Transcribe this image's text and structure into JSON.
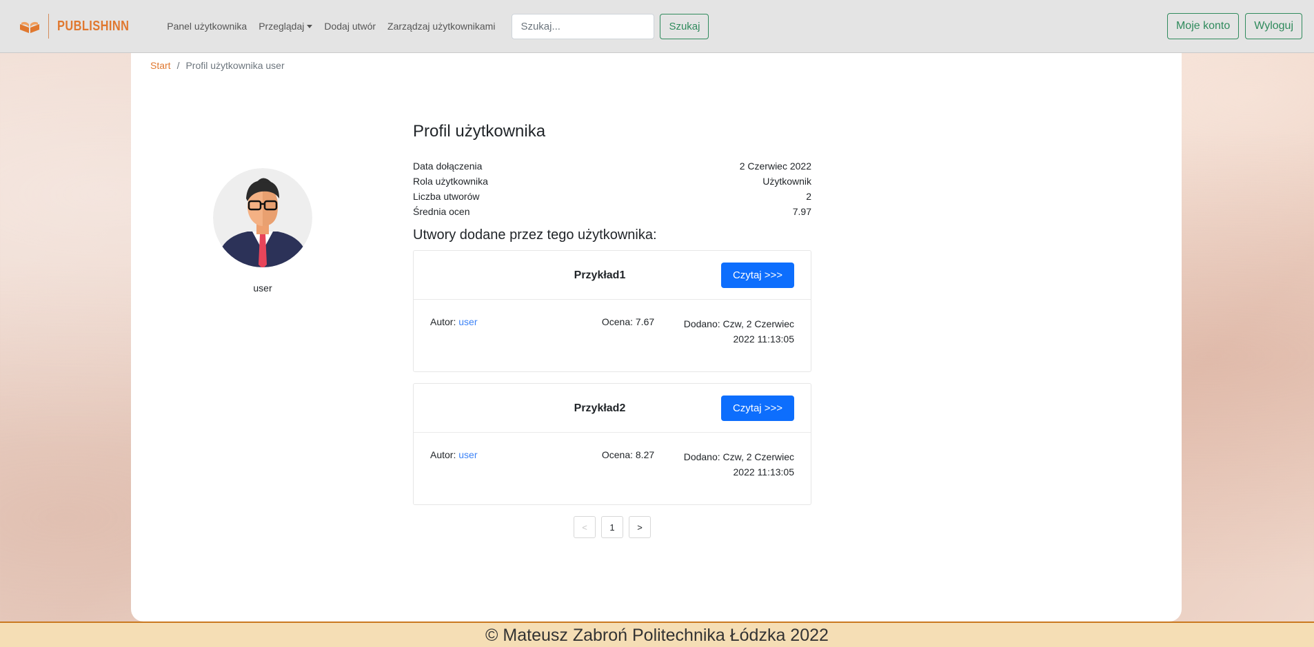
{
  "navbar": {
    "brand": "PUBLISHINN",
    "links": {
      "panel": "Panel użytkownika",
      "browse": "Przeglądaj",
      "add": "Dodaj utwór",
      "manage": "Zarządzaj użytkownikami"
    },
    "search_placeholder": "Szukaj...",
    "search_button": "Szukaj",
    "account_button": "Moje konto",
    "logout_button": "Wyloguj"
  },
  "breadcrumb": {
    "home": "Start",
    "separator": "/",
    "current": "Profil użytkownika user"
  },
  "profile": {
    "username": "user",
    "title": "Profil użytkownika",
    "info": [
      {
        "label": "Data dołączenia",
        "value": "2 Czerwiec 2022"
      },
      {
        "label": "Rola użytkownika",
        "value": "Użytkownik"
      },
      {
        "label": "Liczba utworów",
        "value": "2"
      },
      {
        "label": "Średnia ocen",
        "value": "7.97"
      }
    ],
    "works_heading": "Utwory dodane przez tego użytkownika:"
  },
  "works": [
    {
      "title": "Przykład1",
      "read_label": "Czytaj >>>",
      "author_label": "Autor:",
      "author": "user",
      "rating": "Ocena: 7.67",
      "added": "Dodano: Czw, 2 Czerwiec 2022 11:13:05"
    },
    {
      "title": "Przykład2",
      "read_label": "Czytaj >>>",
      "author_label": "Autor:",
      "author": "user",
      "rating": "Ocena: 8.27",
      "added": "Dodano: Czw, 2 Czerwiec 2022 11:13:05"
    }
  ],
  "pagination": {
    "prev": "<",
    "current": "1",
    "next": ">"
  },
  "footer": {
    "text": "© Mateusz Zabroń Politechnika Łódzka 2022"
  },
  "colors": {
    "brand": "#e0782f",
    "navbar_bg": "#e4e4e4",
    "outline_green": "#2f8a5c",
    "primary_blue": "#0d6efd",
    "footer_bg": "#f5deb5"
  },
  "icons": {
    "brand_logo": "open-book-icon",
    "avatar": "user-avatar-illustration"
  }
}
